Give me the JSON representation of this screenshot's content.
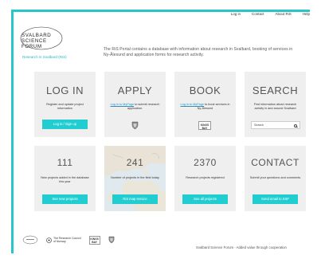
{
  "nav": {
    "items": [
      "Log in",
      "Contact",
      "About RiS",
      "Help"
    ]
  },
  "logo": {
    "line1": "SVALBARD",
    "line2": "SCIENCE",
    "line3": "FORUM"
  },
  "sidebar": {
    "link": "Research in Svalbard (RiS)"
  },
  "intro": {
    "text": "The RiS Portal contains a database with information about research in Svalbard, booking of services in Ny-Ålesund and application forms for research activity."
  },
  "tiles": {
    "login": {
      "title": "LOG IN",
      "desc": "Register and update project information",
      "button": "Log in / Sign up"
    },
    "apply": {
      "title": "APPLY",
      "link": "Log in to MyPage",
      "desc": " to submit research application."
    },
    "book": {
      "title": "BOOK",
      "link": "Log in to MyPage",
      "desc": " to book services in Ny-Ålesund",
      "badge_line1": "KINGS",
      "badge_line2": "BAY"
    },
    "search": {
      "title": "SEARCH",
      "desc": "Find information about research activity in and around Svalbard",
      "placeholder": "Search"
    },
    "new_projects": {
      "title": "111",
      "desc": "New projects added in the database this year",
      "button": "See new projects"
    },
    "map": {
      "title": "241",
      "desc": "Number of projects in the field today",
      "button": "RiS map service"
    },
    "registered": {
      "title": "2370",
      "desc": "Research projects registered",
      "button": "See all projects"
    },
    "contact": {
      "title": "CONTACT",
      "desc": "Submit your questions and comments",
      "button": "Send email to SSF"
    }
  },
  "footer": {
    "rcn_line1": "The Research Council",
    "rcn_line2": "of Norway",
    "kb_line1": "KINGS",
    "kb_line2": "BAY",
    "tagline": "Svalbard Science Forum - Added value through cooperation"
  },
  "colors": {
    "accent": "#27c7c9",
    "button": "#22cdd2",
    "tile": "#efefef"
  }
}
